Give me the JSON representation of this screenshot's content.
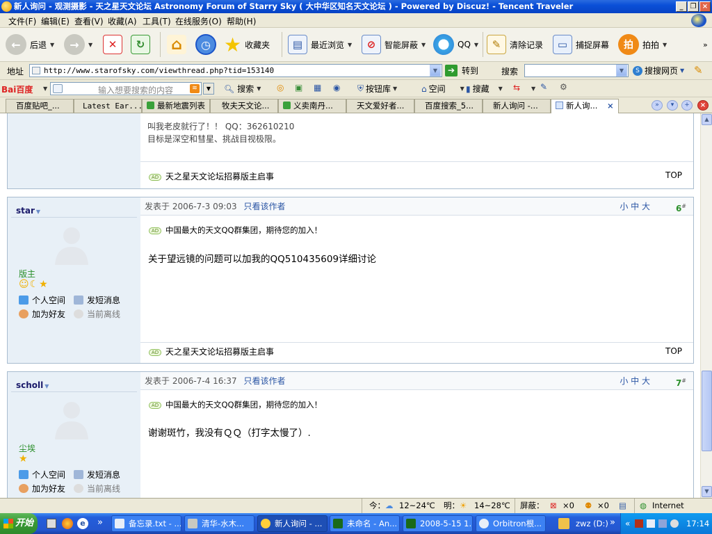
{
  "window": {
    "title": "新人询问 - 观测摄影 - 天之星天文论坛 Astronomy Forum of Starry Sky ( 大中华区知名天文论坛 ) - Powered by Discuz! - Tencent Traveler"
  },
  "menu": [
    "文件(F)",
    "编辑(E)",
    "查看(V)",
    "收藏(A)",
    "工具(T)",
    "在线服务(O)",
    "帮助(H)"
  ],
  "toolbar": {
    "back": "后退",
    "favorites": "收藏夹",
    "recent": "最近浏览",
    "block": "智能屏蔽",
    "qq": "QQ",
    "clear": "清除记录",
    "capture": "捕捉屏幕",
    "paipai": "拍拍",
    "paipai_glyph": "拍"
  },
  "address": {
    "label": "地址",
    "url": "http://www.starofsky.com/viewthread.php?tid=153140",
    "go": "转到",
    "search_label": "搜索",
    "search_web": "搜搜网页"
  },
  "baidu": {
    "logo": "Bai百度",
    "placeholder": "输入想要搜索的内容",
    "search": "搜索",
    "buttons": "按钮库",
    "space": "空间",
    "souyi": "搜藏"
  },
  "tabs": [
    "百度贴吧_...",
    "Latest Ear...",
    "最新地震列表",
    "牧夫天文论...",
    "义卖南丹...",
    "天文爱好者...",
    "百度搜索_5...",
    "新人询问 -...",
    "新人询..."
  ],
  "posts": [
    {
      "sig_line1": "叫我老皮就行了！！  QQ：362610210",
      "sig_line2": "目标是深空和彗星、挑战目视极限。",
      "ad": "天之星天文论坛招募版主启事",
      "top": "TOP"
    },
    {
      "user": "star",
      "rank": "版主",
      "date": "发表于  2006-7-3 09:03",
      "only_author": "只看该作者",
      "size_controls": "小  中  大",
      "floor": "6",
      "ad_top": "中国最大的天文QQ群集团，期待您的加入！",
      "message": "关于望远镜的问题可以加我的QQ510435609详细讨论",
      "ad": "天之星天文论坛招募版主启事",
      "top": "TOP"
    },
    {
      "user": "scholl",
      "rank": "尘埃",
      "date": "发表于  2006-7-4 16:37",
      "only_author": "只看该作者",
      "size_controls": "小  中  大",
      "floor": "7",
      "ad_top": "中国最大的天文QQ群集团，期待您的加入！",
      "message": "谢谢斑竹，我没有ＱＱ（打字太慢了）."
    }
  ],
  "profile_links": {
    "space": "个人空间",
    "pm": "发短消息",
    "friend": "加为好友",
    "offline": "当前离线"
  },
  "ad_badge": "AD",
  "floor_suffix": "#",
  "statusbar": {
    "today": "今：",
    "today_temp": "12~24℃",
    "tomorrow": "明：",
    "tomorrow_temp": "14~28℃",
    "block": "屏蔽：",
    "x1": "×0",
    "x2": "×0",
    "zone": "Internet"
  },
  "taskbar": {
    "start": "开始",
    "tasks": [
      "备忘录.txt - ...",
      "清华-水木...",
      "新人询问 - ...",
      "未命名 - An...",
      "2008-5-15 1...",
      "Orbitron根..."
    ],
    "drive": "zwz (D:)",
    "clock": "17:14"
  },
  "colors": {
    "titlebar": "#0a4fd8",
    "accent_blue": "#2a55a4",
    "rank_green": "#2a8f2a",
    "taskbar": "#2457d0"
  }
}
